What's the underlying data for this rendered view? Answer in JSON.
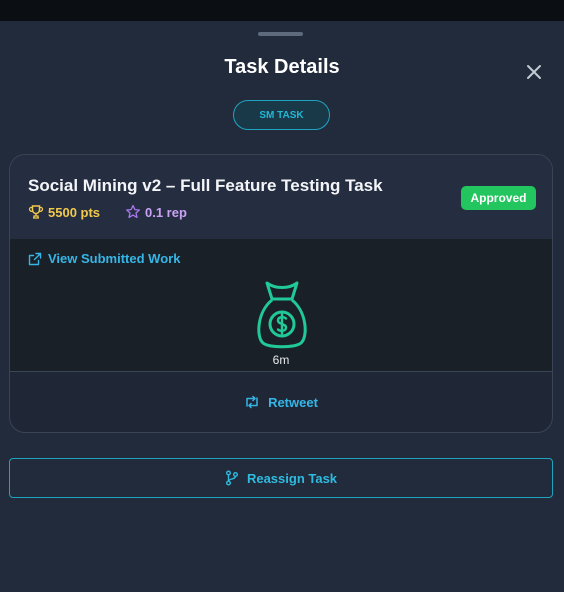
{
  "modal": {
    "title": "Task Details",
    "chip": "SM TASK"
  },
  "task": {
    "title": "Social Mining v2 – Full Feature Testing Task",
    "points": "5500 pts",
    "reputation": "0.1 rep",
    "status": "Approved",
    "view_link": "View Submitted Work",
    "elapsed": "6m",
    "action": "Retweet"
  },
  "footer": {
    "reassign": "Reassign Task"
  },
  "icons": {
    "close": "close-icon",
    "trophy": "trophy-icon",
    "star": "star-icon",
    "external_link": "external-link-icon",
    "money_bag": "money-bag-icon",
    "retweet": "retweet-icon",
    "branch": "branch-icon"
  },
  "colors": {
    "accent": "#35b6e6",
    "success": "#22c55e",
    "points": "#f2c94c",
    "reputation": "#c9a2f5",
    "money_bag": "#20c997"
  }
}
